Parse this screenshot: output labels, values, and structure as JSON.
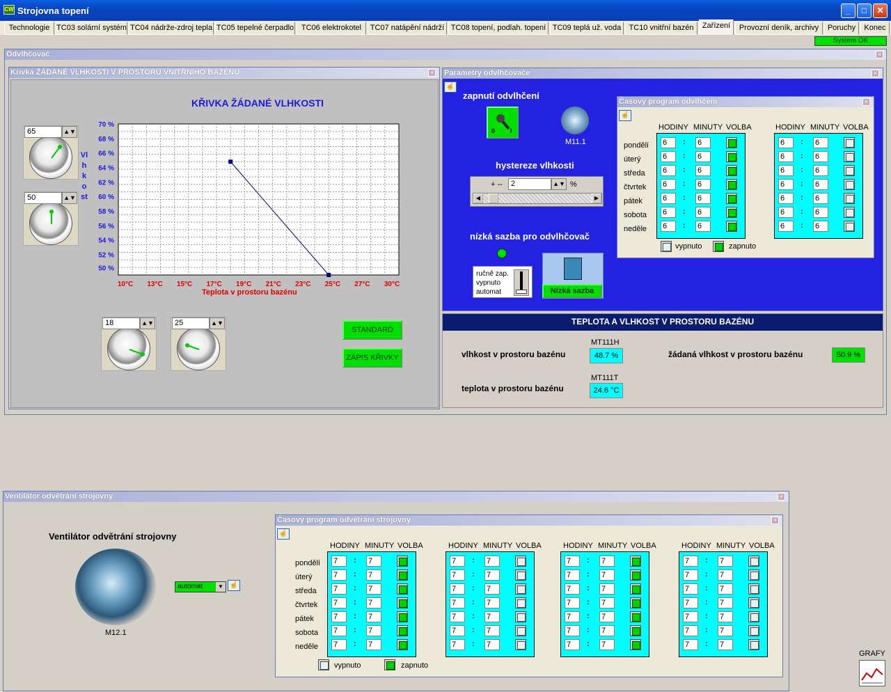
{
  "window": {
    "title": "Strojovna topení",
    "icon": "CW"
  },
  "tabs": [
    "Technologie",
    "TC03 solární systém",
    "TC04 nádrže-zdroj tepla",
    "TC05 tepelné čerpadlo",
    "TC06 elektrokotel",
    "TC07 natápění nádrží",
    "TC08 topení, podlah. topení",
    "TC09 teplá už. voda",
    "TC10 vnitřní bazén",
    "Zařízení",
    "Provozní deník, archivy",
    "Poruchy",
    "Konec"
  ],
  "status": "System OK",
  "odvlhcovac": {
    "title": "Odvlhčovač"
  },
  "curve": {
    "panel_title": "Křivka ŽÁDANÉ VLHKOSTI V PROSTORU VNITŘNÍHO BAZÉNU",
    "heading": "KŘIVKA ŽÁDANÉ VLHKOSTI",
    "spin_max": "65",
    "spin_min": "50",
    "spin_t1": "18",
    "spin_t2": "25",
    "btn_standard": "STANDARD",
    "btn_write": "ZÁPIS KŘIVKY"
  },
  "chart_data": {
    "type": "line",
    "xlabel": "Teplota v prostoru bazénu",
    "ylabel": "Vlhkost",
    "x_ticks": [
      "10°C",
      "13°C",
      "15°C",
      "17°C",
      "19°C",
      "21°C",
      "23°C",
      "25°C",
      "27°C",
      "30°C"
    ],
    "y_ticks": [
      "70 %",
      "68 %",
      "66 %",
      "64 %",
      "62 %",
      "60 %",
      "58 %",
      "56 %",
      "54 %",
      "52 %",
      "50 %"
    ],
    "xlim": [
      10,
      30
    ],
    "ylim": [
      50,
      70
    ],
    "series": [
      {
        "x": [
          18,
          25
        ],
        "y": [
          65,
          50
        ]
      }
    ],
    "grid": true
  },
  "params": {
    "panel_title": "Parametry odvlhčovače",
    "on_label": "zapnutí odvlhčení",
    "switch_0": "0",
    "switch_1": "I",
    "fan_label": "M11.1",
    "hyst_label": "hystereze vlhkosti",
    "hyst_prefix": "+ --",
    "hyst_value": "2",
    "hyst_unit": "%",
    "low_label": "nízká sazba pro odvlhčovač",
    "modes": [
      "ručně zap.",
      "vypnuto",
      "automat"
    ],
    "low_button": "Nízká sazba"
  },
  "humsched": {
    "title": "Časový program odvlhčení",
    "headers": [
      "HODINY",
      "MINUTY",
      "VOLBA"
    ],
    "days": [
      "pondělí",
      "úterý",
      "středa",
      "čtvrtek",
      "pátek",
      "sobota",
      "neděle"
    ],
    "left": {
      "h": [
        "6",
        "6",
        "6",
        "6",
        "6",
        "6",
        "6"
      ],
      "m": [
        "6",
        "6",
        "6",
        "6",
        "6",
        "6",
        "6"
      ]
    },
    "right": {
      "h": [
        "6",
        "6",
        "6",
        "6",
        "6",
        "6",
        "6"
      ],
      "m": [
        "6",
        "6",
        "6",
        "6",
        "6",
        "6",
        "6"
      ]
    },
    "legend_off": "vypnuto",
    "legend_on": "zapnuto"
  },
  "pool": {
    "title": "TEPLOTA A VLHKOST V PROSTORU BAZÉNU",
    "hum_label": "vlhkost v prostoru bazénu",
    "hum_tag": "MT111H",
    "hum_value": "48.7 %",
    "temp_label": "teplota v prostoru bazénu",
    "temp_tag": "MT111T",
    "temp_value": "24.6 °C",
    "set_label": "žádaná vlhkost v prostoru bazénu",
    "set_value": "50.9 %"
  },
  "vent": {
    "panel_title": "Ventilátor odvětrání strojovny",
    "heading": "Ventilátor odvětrání strojovny",
    "fan_label": "M12.1",
    "mode": "automat"
  },
  "ventsched": {
    "title": "Časový program odvětrání strojovny",
    "value": "7",
    "legend_off": "vypnuto",
    "legend_on": "zapnuto"
  },
  "grafy": "GRAFY"
}
